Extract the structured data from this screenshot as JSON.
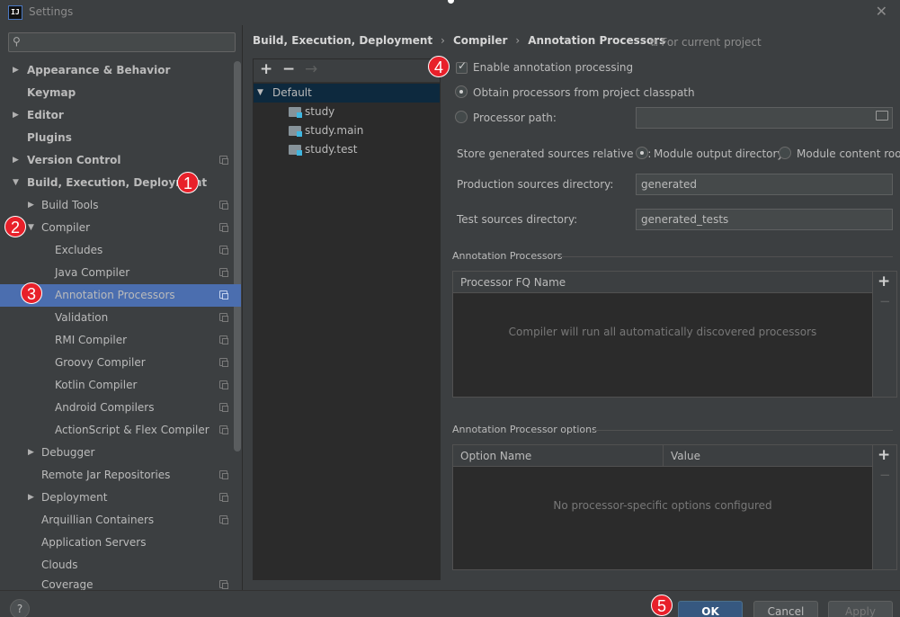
{
  "window": {
    "app_icon": "IJ",
    "title": "Settings",
    "close_icon": "✕"
  },
  "sidebar": {
    "search_placeholder": "",
    "items": [
      {
        "label": "Appearance & Behavior"
      },
      {
        "label": "Keymap"
      },
      {
        "label": "Editor"
      },
      {
        "label": "Plugins"
      },
      {
        "label": "Version Control"
      },
      {
        "label": "Build, Execution, Deployment"
      },
      {
        "label": "Build Tools"
      },
      {
        "label": "Compiler"
      },
      {
        "label": "Excludes"
      },
      {
        "label": "Java Compiler"
      },
      {
        "label": "Annotation Processors"
      },
      {
        "label": "Validation"
      },
      {
        "label": "RMI Compiler"
      },
      {
        "label": "Groovy Compiler"
      },
      {
        "label": "Kotlin Compiler"
      },
      {
        "label": "Android Compilers"
      },
      {
        "label": "ActionScript & Flex Compiler"
      },
      {
        "label": "Debugger"
      },
      {
        "label": "Remote Jar Repositories"
      },
      {
        "label": "Deployment"
      },
      {
        "label": "Arquillian Containers"
      },
      {
        "label": "Application Servers"
      },
      {
        "label": "Clouds"
      },
      {
        "label": "Coverage"
      }
    ]
  },
  "badges": [
    "1",
    "2",
    "3",
    "4",
    "5"
  ],
  "breadcrumb": {
    "parts": [
      "Build, Execution, Deployment",
      "Compiler",
      "Annotation Processors"
    ],
    "separator": "›",
    "scope_icon": "⧉",
    "scope": "For current project"
  },
  "profiles": {
    "toolbar": {
      "add": "+",
      "remove": "−",
      "move": "→"
    },
    "root": "Default",
    "modules": [
      "study",
      "study.main",
      "study.test"
    ]
  },
  "form": {
    "enable_label": "Enable annotation processing",
    "enable_checked": true,
    "obtain_label": "Obtain processors from project classpath",
    "processor_path_label": "Processor path:",
    "processor_path_value": "",
    "store_label": "Store generated sources relative to:",
    "module_output_label": "Module output directory",
    "module_content_label": "Module content root",
    "production_label": "Production sources directory:",
    "production_value": "generated",
    "test_label": "Test sources directory:",
    "test_value": "generated_tests"
  },
  "processors_section": {
    "title": "Annotation Processors",
    "column": "Processor FQ Name",
    "empty": "Compiler will run all automatically discovered processors"
  },
  "options_section": {
    "title": "Annotation Processor options",
    "columns": [
      "Option Name",
      "Value"
    ],
    "empty": "No processor-specific options configured"
  },
  "table_tools": {
    "add": "+",
    "remove": "−"
  },
  "footer": {
    "help": "?",
    "ok": "OK",
    "cancel": "Cancel",
    "apply": "Apply"
  }
}
